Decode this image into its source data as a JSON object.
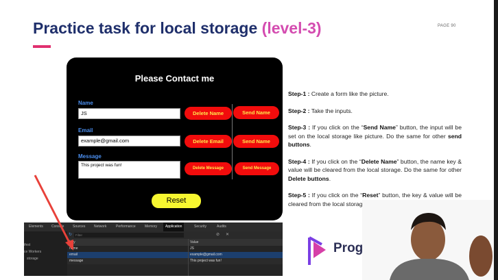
{
  "slide": {
    "title_main": "Practice task for local storage ",
    "title_highlight": "(level-3)",
    "page_number": "PAGE 90"
  },
  "form": {
    "heading": "Please Contact me",
    "name_label": "Name",
    "name_value": "JS",
    "email_label": "Email",
    "email_value": "example@gmail.com",
    "message_label": "Message",
    "message_value": "This project was fun!",
    "delete_name": "Delete Name",
    "send_name": "Send Name",
    "delete_email": "Delete Email",
    "send_email": "Send Name",
    "delete_message": "Delete Message",
    "send_message": "Send Message",
    "reset": "Reset"
  },
  "steps": [
    {
      "label": "Step-1 :",
      "pre": " Create a form like the picture.",
      "b1": "",
      "mid": "",
      "b2": "",
      "post": ""
    },
    {
      "label": "Step-2 :",
      "pre": " Take the inputs.",
      "b1": "",
      "mid": "",
      "b2": "",
      "post": ""
    },
    {
      "label": "Step-3 :",
      "pre": " If you click on the “",
      "b1": "Send Name",
      "mid": "” button, the input will be set on the local storage like picture. Do the same for other ",
      "b2": "send buttons",
      "post": "."
    },
    {
      "label": "Step-4 :",
      "pre": " If you click on the “",
      "b1": "Delete Name",
      "mid": "” button, the name key & value will be cleared from the local storage. Do the same for other ",
      "b2": "Delete buttons",
      "post": "."
    },
    {
      "label": "Step-5 :",
      "pre": " If you click on the “",
      "b1": "Reset",
      "mid": "” button, the key & value will be cleared from the local storage",
      "b2": "",
      "post": ""
    }
  ],
  "devtools": {
    "tabs": [
      "Elements",
      "Console",
      "Sources",
      "Network",
      "Performance",
      "Memory",
      "Application",
      "Security",
      "Audits"
    ],
    "active_tab": "Application",
    "sidebar": [
      "ifest",
      "ce Workers",
      "storage"
    ],
    "filter_placeholder": "Filter",
    "columns": [
      "Key",
      "Value"
    ],
    "rows": [
      {
        "key": "name",
        "value": "JS"
      },
      {
        "key": "email",
        "value": "example@gmail.com"
      },
      {
        "key": "message",
        "value": "This project was fun!"
      }
    ]
  },
  "logo": {
    "text": "Programming Hero"
  },
  "colors": {
    "title": "#1f2f6b",
    "title_highlight": "#d44cb0",
    "button_red": "#f20c0c",
    "button_text": "#ffe94d",
    "reset_yellow": "#f7f730",
    "label_blue": "#4b8ff0",
    "arrow_red": "#e8413a"
  }
}
